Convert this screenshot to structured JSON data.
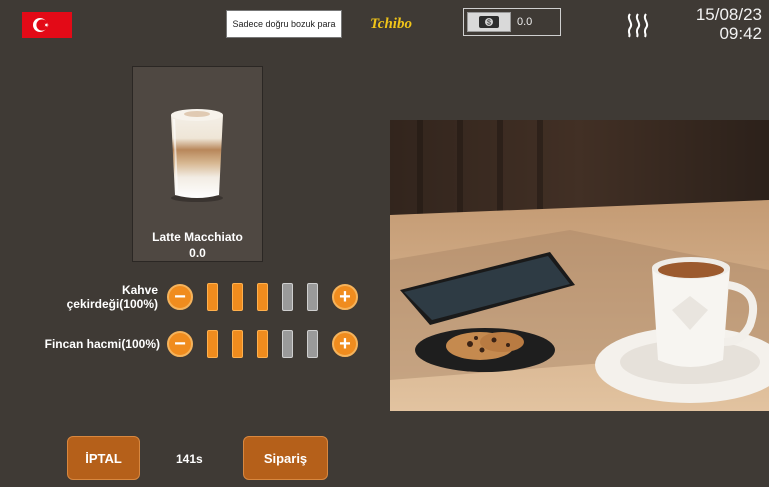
{
  "topbar": {
    "flag_icon": "turkey-flag-icon",
    "cash_note": "Sadece doğru bozuk para",
    "brand": "Tchibo",
    "credit_icon": "coin-card-icon",
    "credit": "0.0",
    "heat_icon": "steam-icon",
    "date": "15/08/23",
    "time": "09:42"
  },
  "product": {
    "name": "Latte Macchiato",
    "price": "0.0",
    "image_icon": "latte-glass-icon"
  },
  "settings": [
    {
      "label_line1": "Kahve",
      "label_line2": "çekirdeği(100%)",
      "level": 3,
      "max": 5
    },
    {
      "label": "Fincan hacmi(100%)",
      "level": 3,
      "max": 5
    }
  ],
  "actions": {
    "cancel_label": "İPTAL",
    "timer": "141s",
    "order_label": "Sipariş"
  },
  "colors": {
    "background": "#3f3a35",
    "accent": "#f08c1e",
    "button": "#b5601a",
    "flag": "#e30a17"
  }
}
